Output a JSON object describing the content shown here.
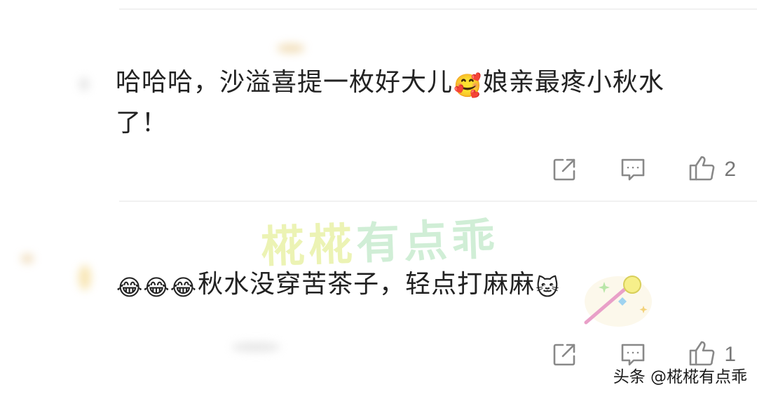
{
  "comments": [
    {
      "text_before_emoji": "哈哈哈，沙溢喜提一枚好大儿",
      "emoji_1": "🥰",
      "text_after_emoji": "娘亲最疼小秋水了！",
      "actions": {
        "share_icon": "share-icon",
        "reply_icon": "reply-icon",
        "like_icon": "thumbs-up-icon",
        "like_count": "2"
      }
    },
    {
      "emoji_prefix": "😂😂😂",
      "text": "秋水没穿苦茶子，轻点打麻麻",
      "emoji_suffix": "🐱",
      "actions": {
        "share_icon": "share-icon",
        "reply_icon": "reply-icon",
        "like_icon": "thumbs-up-icon",
        "like_count": "1"
      }
    }
  ],
  "watermark": {
    "text_part1": "椛椛",
    "text_part2": "有点乖"
  },
  "credit": "头条 @椛椛有点乖",
  "colors": {
    "text": "#222222",
    "icon": "#888888",
    "divider": "#f1f1f1",
    "watermark_yellow": "#e9f2a8",
    "watermark_green": "#c8ecd0"
  }
}
